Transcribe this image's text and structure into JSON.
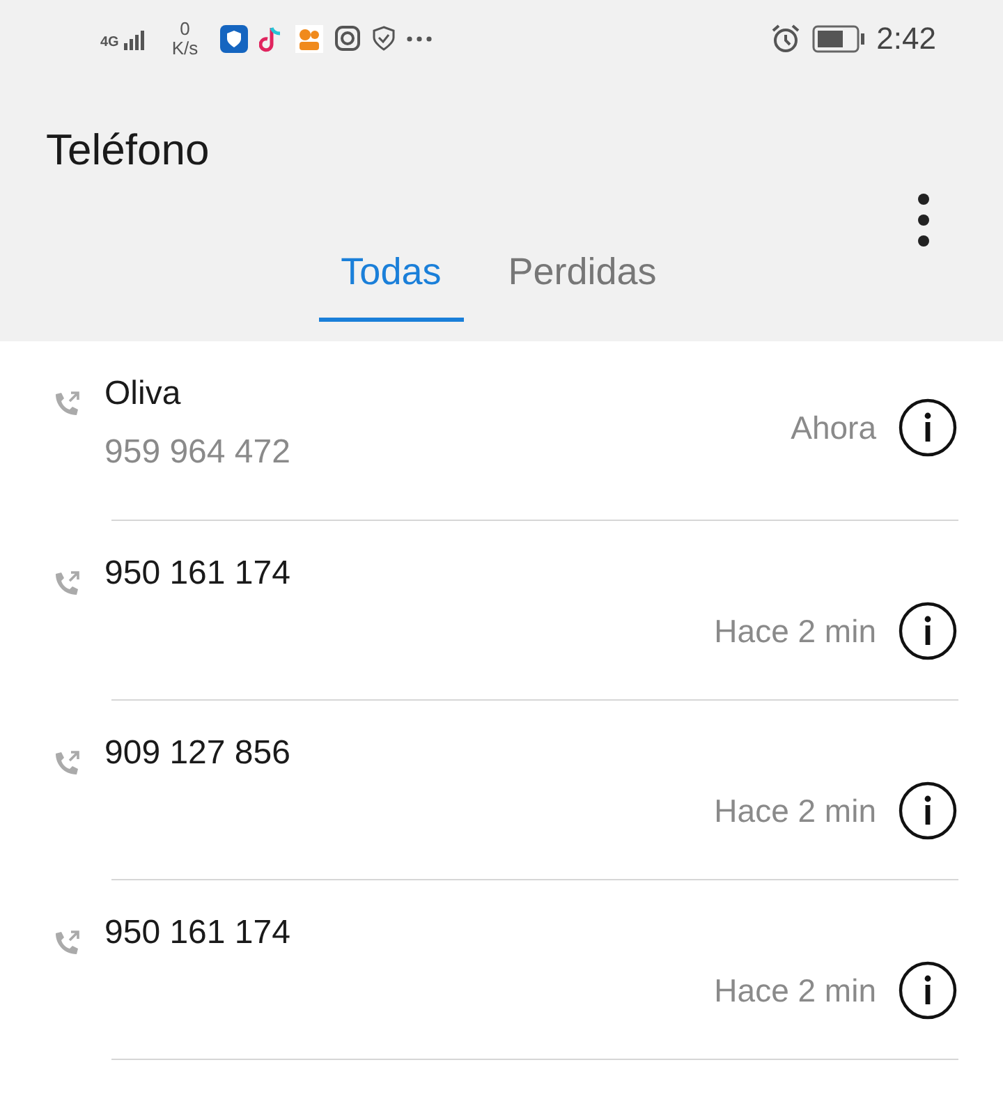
{
  "status_bar": {
    "network": "4G",
    "speed_value": "0",
    "speed_unit": "K/s",
    "time": "2:42"
  },
  "app_bar": {
    "title": "Teléfono"
  },
  "tabs": [
    {
      "label": "Todas",
      "selected": true
    },
    {
      "label": "Perdidas",
      "selected": false
    }
  ],
  "calls": [
    {
      "name": "Oliva",
      "number": "959 964 472",
      "time": "Ahora"
    },
    {
      "name": "950 161 174",
      "time": "Hace 2 min"
    },
    {
      "name": "909 127 856",
      "time": "Hace 2 min"
    },
    {
      "name": "950 161 174",
      "time": "Hace 2 min"
    }
  ]
}
